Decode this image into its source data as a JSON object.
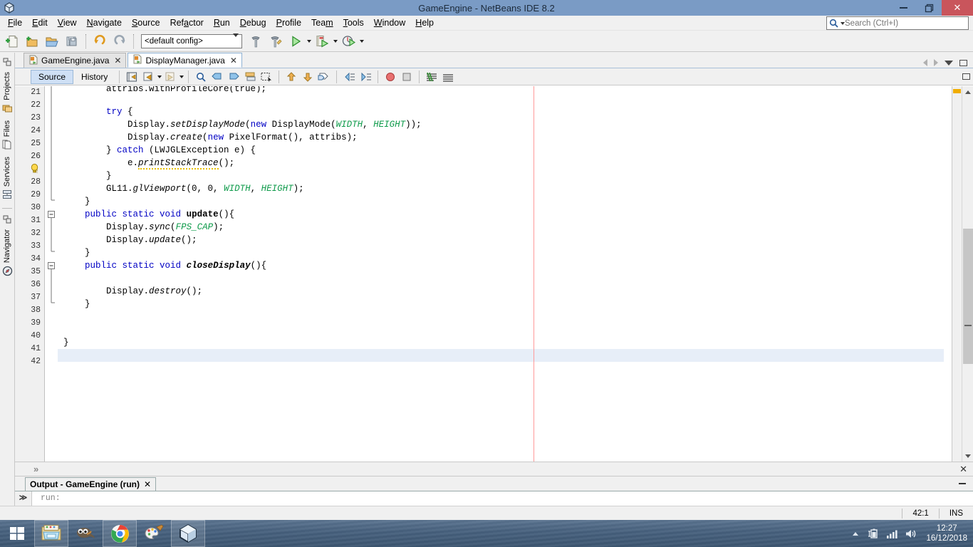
{
  "window": {
    "title": "GameEngine - NetBeans IDE 8.2",
    "app_icon": "netbeans-cube-icon",
    "buttons": {
      "minimize": "minimize",
      "restore": "restore",
      "close": "close"
    }
  },
  "menubar": {
    "items": [
      {
        "label": "File",
        "mnemonic": "F"
      },
      {
        "label": "Edit",
        "mnemonic": "E"
      },
      {
        "label": "View",
        "mnemonic": "V"
      },
      {
        "label": "Navigate",
        "mnemonic": "N"
      },
      {
        "label": "Source",
        "mnemonic": "S"
      },
      {
        "label": "Refactor",
        "mnemonic": "a"
      },
      {
        "label": "Run",
        "mnemonic": "R"
      },
      {
        "label": "Debug",
        "mnemonic": "D"
      },
      {
        "label": "Profile",
        "mnemonic": "P"
      },
      {
        "label": "Team",
        "mnemonic": "m"
      },
      {
        "label": "Tools",
        "mnemonic": "T"
      },
      {
        "label": "Window",
        "mnemonic": "W"
      },
      {
        "label": "Help",
        "mnemonic": "H"
      }
    ]
  },
  "search": {
    "placeholder": "Search (Ctrl+I)",
    "value": "",
    "icon": "search-icon"
  },
  "toolbar": {
    "config_value": "<default config>",
    "buttons": [
      "new-file-icon",
      "new-project-icon",
      "open-project-icon",
      "save-all-icon",
      "undo-icon",
      "redo-icon",
      "build-project-icon",
      "clean-and-build-icon",
      "run-project-icon",
      "debug-project-icon",
      "profile-project-icon"
    ]
  },
  "left_rail": {
    "items": [
      {
        "label": "Projects",
        "icon": "projects-icon"
      },
      {
        "label": "Files",
        "icon": "files-icon"
      },
      {
        "label": "Services",
        "icon": "services-icon"
      },
      {
        "label": "Navigator",
        "icon": "navigator-icon"
      }
    ]
  },
  "document_tabs": [
    {
      "label": "GameEngine.java",
      "icon": "java-file-icon",
      "active": false,
      "close": "✕"
    },
    {
      "label": "DisplayManager.java",
      "icon": "java-file-icon",
      "active": true,
      "close": "✕"
    }
  ],
  "source_toolbar": {
    "tabs": [
      {
        "label": "Source",
        "selected": true
      },
      {
        "label": "History",
        "selected": false
      }
    ],
    "buttons": [
      "last-edit-icon",
      "back-icon",
      "forward-icon",
      "find-selection-icon",
      "previous-bookmark-icon",
      "next-bookmark-icon",
      "toggle-bookmark-icon",
      "toggle-rectangular-selection-icon",
      "previous-error-icon",
      "next-error-icon",
      "shift-left-icon",
      "shift-right-icon",
      "start-macro-recording-icon",
      "stop-macro-recording-icon",
      "comment-icon",
      "uncomment-icon"
    ]
  },
  "editor": {
    "lines": [
      {
        "num": "21",
        "clipped": true,
        "tokens": [
          {
            "t": "        attribs.withProfileCore(true);",
            "c": "plain"
          }
        ]
      },
      {
        "num": "22",
        "tokens": []
      },
      {
        "num": "23",
        "tokens": [
          {
            "t": "        ",
            "c": "plain"
          },
          {
            "t": "try",
            "c": "kw"
          },
          {
            "t": " {",
            "c": "plain"
          }
        ]
      },
      {
        "num": "24",
        "tokens": [
          {
            "t": "            Display.",
            "c": "plain"
          },
          {
            "t": "setDisplayMode",
            "c": "method-it"
          },
          {
            "t": "(",
            "c": "plain"
          },
          {
            "t": "new",
            "c": "kw"
          },
          {
            "t": " DisplayMode(",
            "c": "plain"
          },
          {
            "t": "WIDTH",
            "c": "static-field"
          },
          {
            "t": ", ",
            "c": "plain"
          },
          {
            "t": "HEIGHT",
            "c": "static-field"
          },
          {
            "t": "));",
            "c": "plain"
          }
        ]
      },
      {
        "num": "25",
        "tokens": [
          {
            "t": "            Display.",
            "c": "plain"
          },
          {
            "t": "create",
            "c": "method-it"
          },
          {
            "t": "(",
            "c": "plain"
          },
          {
            "t": "new",
            "c": "kw"
          },
          {
            "t": " PixelFormat(), attribs);",
            "c": "plain"
          }
        ]
      },
      {
        "num": "26",
        "tokens": [
          {
            "t": "        } ",
            "c": "plain"
          },
          {
            "t": "catch",
            "c": "kw"
          },
          {
            "t": " (LWJGLException e) {",
            "c": "plain"
          }
        ]
      },
      {
        "num": "27",
        "icon": "warning-bulb-icon",
        "tokens": [
          {
            "t": "            e.",
            "c": "plain"
          },
          {
            "t": "printStackTrace",
            "c": "warnunl"
          },
          {
            "t": "();",
            "c": "plain"
          }
        ]
      },
      {
        "num": "28",
        "tokens": [
          {
            "t": "        }",
            "c": "plain"
          }
        ]
      },
      {
        "num": "29",
        "tokens": [
          {
            "t": "        GL11.",
            "c": "plain"
          },
          {
            "t": "glViewport",
            "c": "method-it"
          },
          {
            "t": "(0, 0, ",
            "c": "plain"
          },
          {
            "t": "WIDTH",
            "c": "static-field"
          },
          {
            "t": ", ",
            "c": "plain"
          },
          {
            "t": "HEIGHT",
            "c": "static-field"
          },
          {
            "t": ");",
            "c": "plain"
          }
        ]
      },
      {
        "num": "30",
        "tokens": [
          {
            "t": "    }",
            "c": "plain"
          }
        ]
      },
      {
        "num": "31",
        "fold": "collapse",
        "tokens": [
          {
            "t": "    ",
            "c": "plain"
          },
          {
            "t": "public static void",
            "c": "kw"
          },
          {
            "t": " ",
            "c": "plain"
          },
          {
            "t": "update",
            "c": "bold"
          },
          {
            "t": "(){",
            "c": "plain"
          }
        ]
      },
      {
        "num": "32",
        "tokens": [
          {
            "t": "        Display.",
            "c": "plain"
          },
          {
            "t": "sync",
            "c": "method-it"
          },
          {
            "t": "(",
            "c": "plain"
          },
          {
            "t": "FPS_CAP",
            "c": "static-field"
          },
          {
            "t": ");",
            "c": "plain"
          }
        ]
      },
      {
        "num": "33",
        "tokens": [
          {
            "t": "        Display.",
            "c": "plain"
          },
          {
            "t": "update",
            "c": "method-it"
          },
          {
            "t": "();",
            "c": "plain"
          }
        ]
      },
      {
        "num": "34",
        "tokens": [
          {
            "t": "    }",
            "c": "plain"
          }
        ]
      },
      {
        "num": "35",
        "fold": "collapse",
        "tokens": [
          {
            "t": "    ",
            "c": "plain"
          },
          {
            "t": "public static void",
            "c": "kw"
          },
          {
            "t": " ",
            "c": "plain"
          },
          {
            "t": "closeDisplay",
            "c": "bold-it"
          },
          {
            "t": "(){",
            "c": "plain"
          }
        ]
      },
      {
        "num": "36",
        "tokens": []
      },
      {
        "num": "37",
        "tokens": [
          {
            "t": "        Display.",
            "c": "plain"
          },
          {
            "t": "destroy",
            "c": "method-it"
          },
          {
            "t": "();",
            "c": "plain"
          }
        ]
      },
      {
        "num": "38",
        "tokens": [
          {
            "t": "    }",
            "c": "plain"
          }
        ]
      },
      {
        "num": "39",
        "tokens": []
      },
      {
        "num": "40",
        "tokens": []
      },
      {
        "num": "41",
        "tokens": [
          {
            "t": "}",
            "c": "plain"
          }
        ]
      },
      {
        "num": "42",
        "current": true,
        "tokens": []
      }
    ],
    "colors": {
      "keyword": "#0000c4",
      "static_field": "#0f9b4b",
      "current_line": "#e7eef8",
      "margin_line": "#ff9999",
      "annotation_warning": "#f0ad00"
    }
  },
  "breadcrumb": {
    "symbol": "»"
  },
  "output": {
    "tab_label": "Output - GameEngine (run)",
    "close": "✕",
    "prompt": "≫",
    "text": "run:"
  },
  "statusbar": {
    "position": "42:1",
    "insert_mode": "INS"
  },
  "taskbar": {
    "items": [
      {
        "name": "start-button",
        "icon": "windows-logo-icon",
        "framed": false
      },
      {
        "name": "file-explorer",
        "icon": "file-explorer-icon",
        "framed": true
      },
      {
        "name": "gimp",
        "icon": "gimp-icon",
        "framed": false
      },
      {
        "name": "google-chrome",
        "icon": "chrome-icon",
        "framed": true
      },
      {
        "name": "paint",
        "icon": "paint-icon",
        "framed": false
      },
      {
        "name": "netbeans",
        "icon": "netbeans-cube-icon",
        "framed": true
      }
    ],
    "tray": [
      "show-hidden-icons",
      "battery-icon",
      "wifi-icon",
      "volume-icon"
    ],
    "clock": {
      "time": "12:27",
      "date": "16/12/2018"
    }
  }
}
